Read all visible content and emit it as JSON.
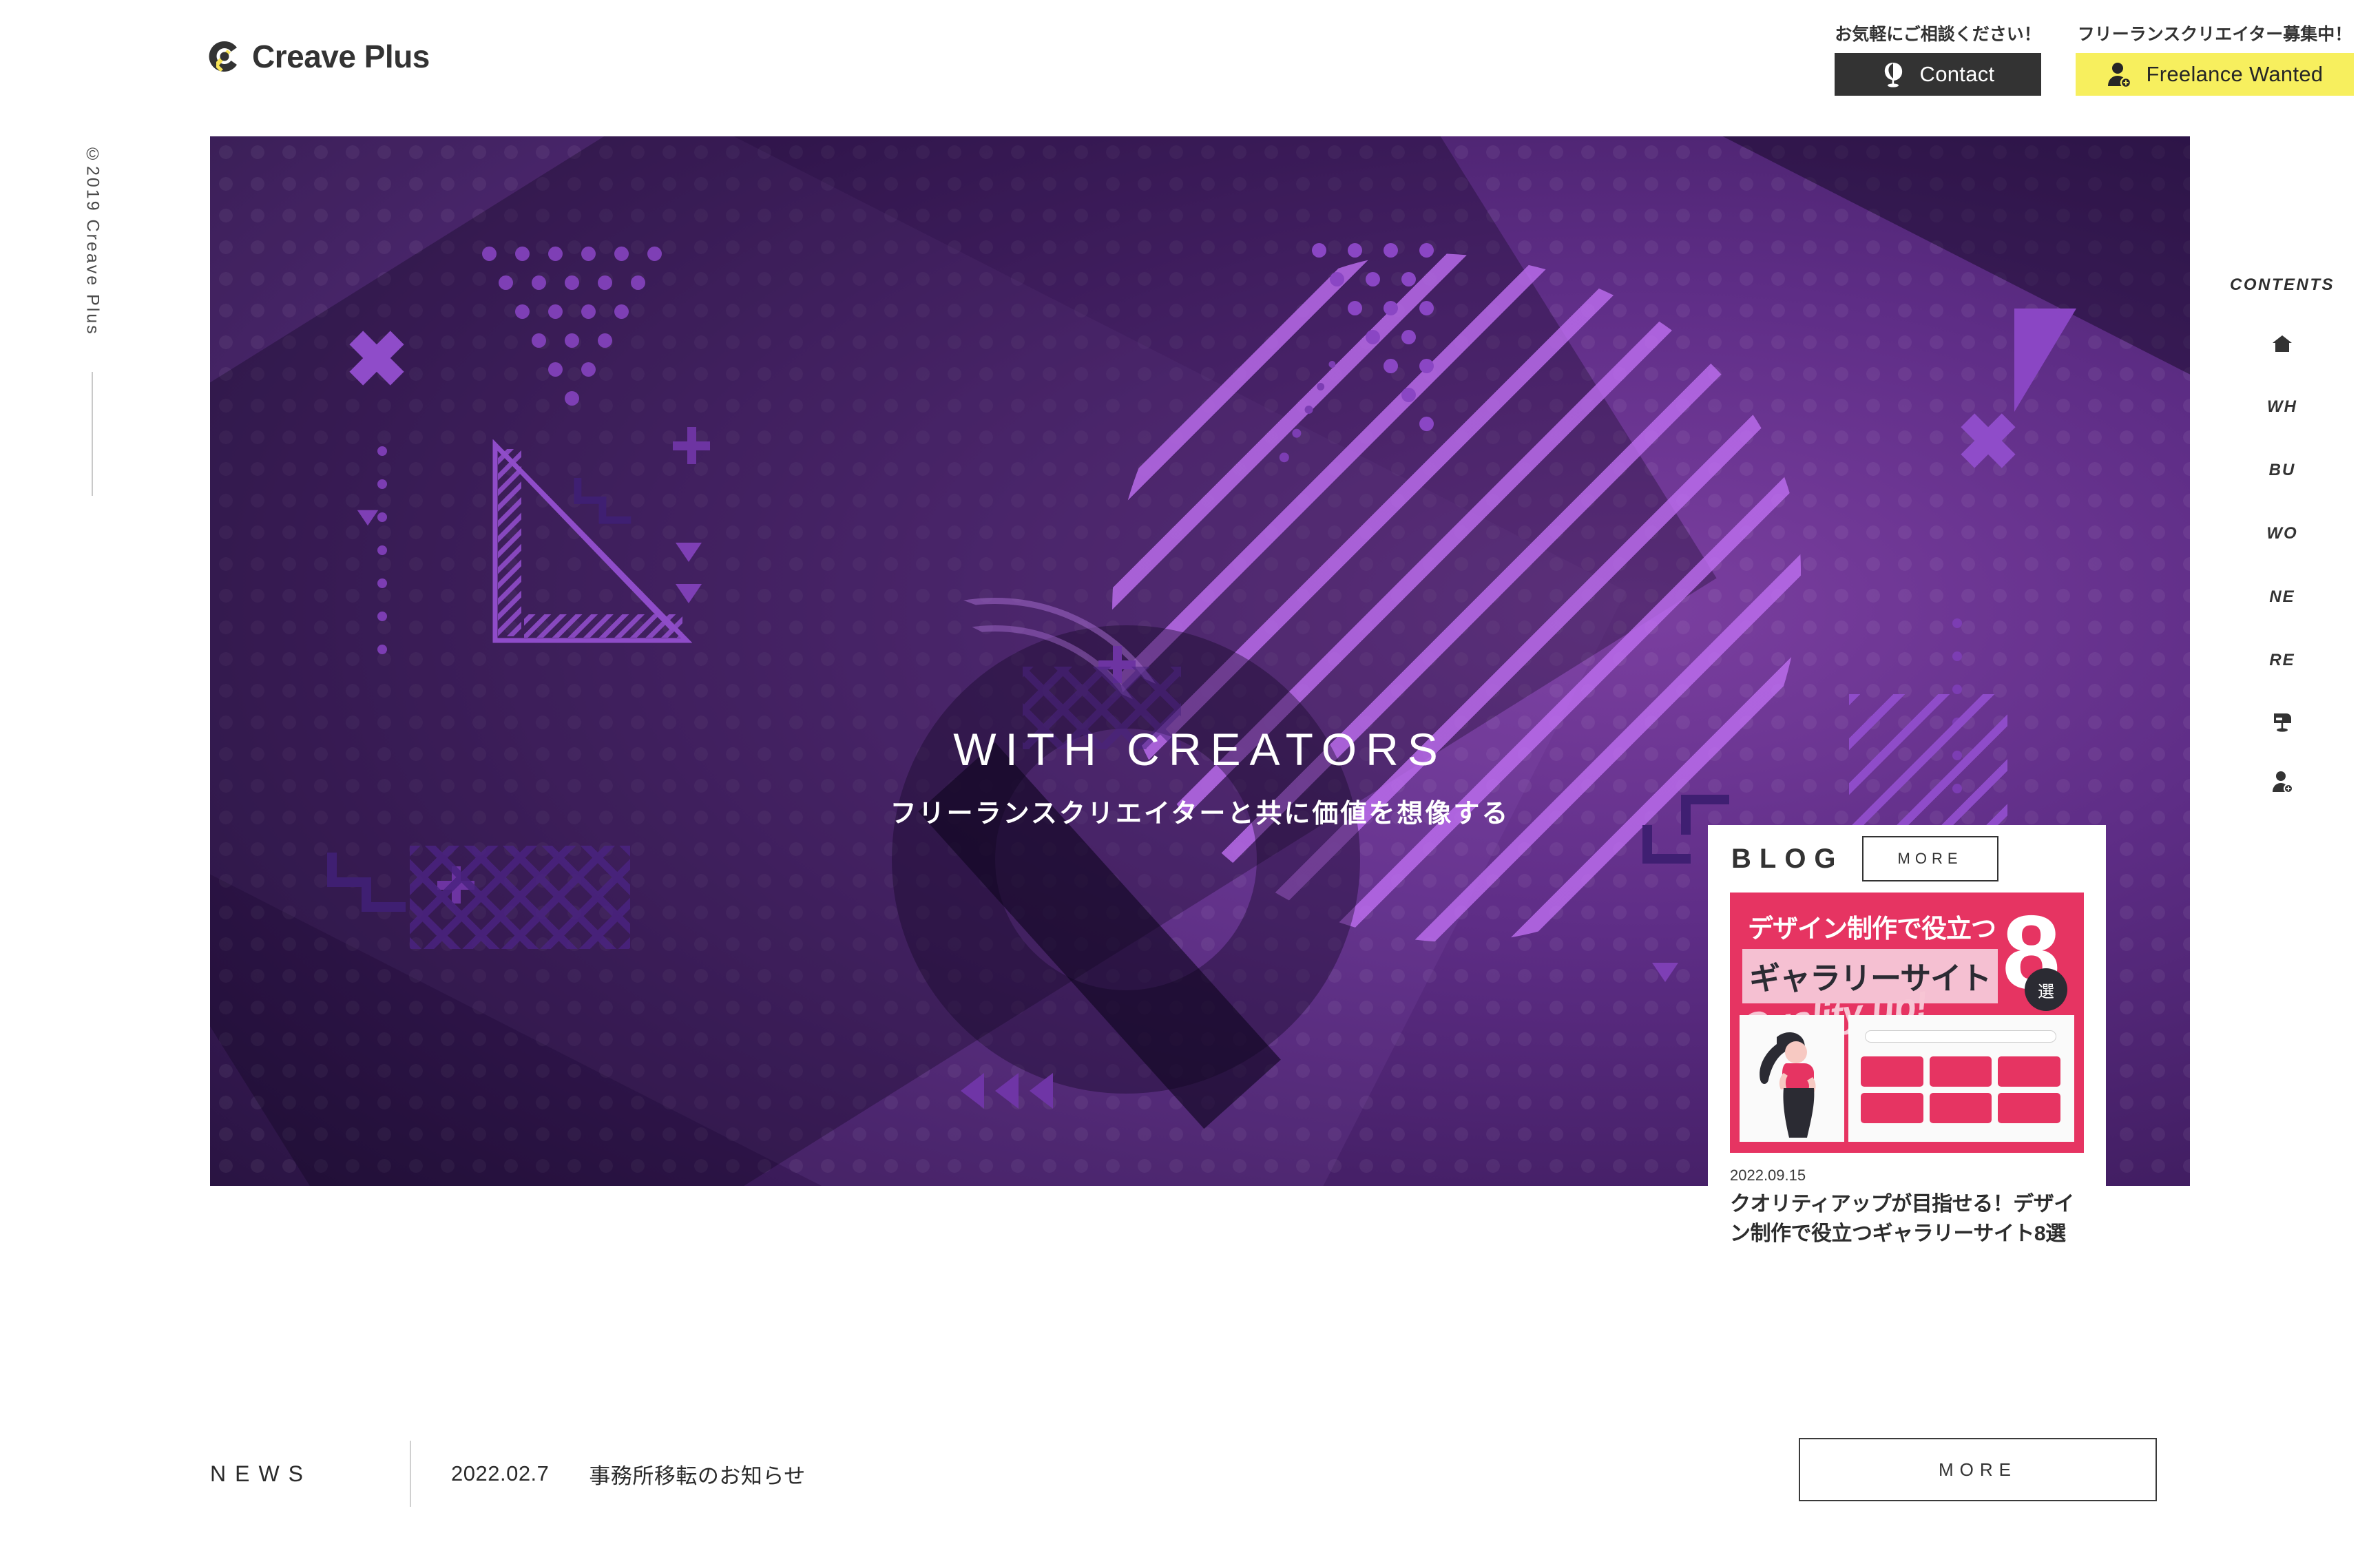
{
  "header": {
    "logo_text": "Creave Plus",
    "logo_icon": "creave-c-mark",
    "actions": [
      {
        "label": "お気軽にご相談ください！",
        "button_text": "Contact",
        "icon": "mail-pin-icon",
        "style": "dark",
        "bg": "#333333",
        "fg": "#ffffff"
      },
      {
        "label": "フリーランスクリエイター募集中！",
        "button_text": "Freelance Wanted",
        "icon": "person-add-icon",
        "style": "yellow",
        "bg": "#f7ef5e",
        "fg": "#262626"
      }
    ]
  },
  "left_rail": {
    "copyright": "©2019 Creave Plus"
  },
  "right_rail": {
    "title": "CONTENTS",
    "items": [
      {
        "label": "",
        "icon": "home-icon"
      },
      {
        "label": "WH",
        "icon": ""
      },
      {
        "label": "BU",
        "icon": ""
      },
      {
        "label": "WO",
        "icon": ""
      },
      {
        "label": "NE",
        "icon": ""
      },
      {
        "label": "RE",
        "icon": ""
      },
      {
        "label": "",
        "icon": "mailbox-icon"
      },
      {
        "label": "",
        "icon": "person-add-icon"
      }
    ]
  },
  "hero": {
    "title": "WITH CREATORS",
    "subtitle": "フリーランスクリエイターと共に価値を想像する",
    "bg_colors": {
      "deep": "#190b2a",
      "mid": "#3e1c5e",
      "light": "#7b3fa0",
      "accent": "#8f4cc9"
    }
  },
  "blog": {
    "section_title": "BLOG",
    "more_label": "MORE",
    "thumbnail": {
      "line1": "デザイン制作で役立つ",
      "line2": "ギャラリーサイト",
      "number": "8",
      "badge": "選",
      "script": "Quality up!",
      "bg_color": "#e63462"
    },
    "date": "2022.09.15",
    "title": "クオリティアップが目指せる！デザイン制作で役立つギャラリーサイト8選"
  },
  "news": {
    "label": "NEWS",
    "date": "2022.02.7",
    "text": "事務所移転のお知らせ",
    "more_label": "MORE"
  }
}
